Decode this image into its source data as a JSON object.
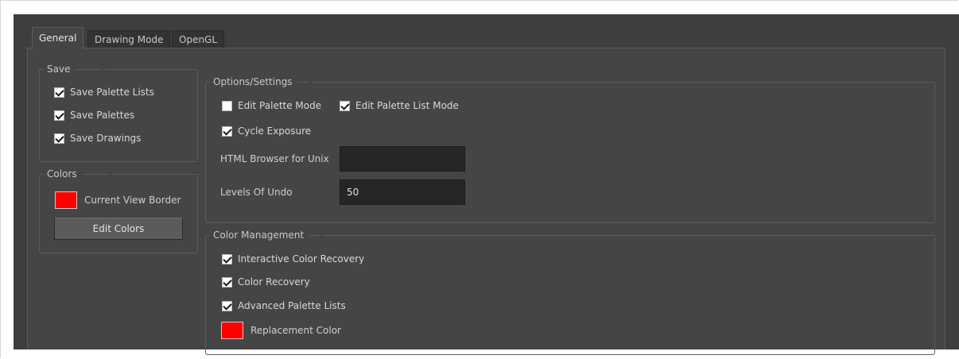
{
  "tabs": [
    {
      "label": "General",
      "active": true
    },
    {
      "label": "Drawing Mode",
      "active": false
    },
    {
      "label": "OpenGL",
      "active": false
    }
  ],
  "save": {
    "title": "Save",
    "items": [
      {
        "label": "Save Palette Lists",
        "checked": true
      },
      {
        "label": "Save Palettes",
        "checked": true
      },
      {
        "label": "Save Drawings",
        "checked": true
      }
    ]
  },
  "colors": {
    "title": "Colors",
    "current_view_border": {
      "label": "Current View Border",
      "color": "#ff0000"
    },
    "edit_colors_button": "Edit Colors"
  },
  "options": {
    "title": "Options/Settings",
    "edit_palette_mode": {
      "label": "Edit Palette Mode",
      "checked": false
    },
    "edit_palette_list_mode": {
      "label": "Edit Palette List Mode",
      "checked": true
    },
    "cycle_exposure": {
      "label": "Cycle Exposure",
      "checked": true
    },
    "html_browser": {
      "label": "HTML Browser for Unix",
      "value": ""
    },
    "levels_of_undo": {
      "label": "Levels Of Undo",
      "value": "50"
    }
  },
  "color_management": {
    "title": "Color Management",
    "items": [
      {
        "label": "Interactive Color Recovery",
        "checked": true
      },
      {
        "label": "Color Recovery",
        "checked": true
      },
      {
        "label": "Advanced Palette Lists",
        "checked": true
      }
    ],
    "replacement_color": {
      "label": "Replacement Color",
      "color": "#ff0000"
    }
  }
}
